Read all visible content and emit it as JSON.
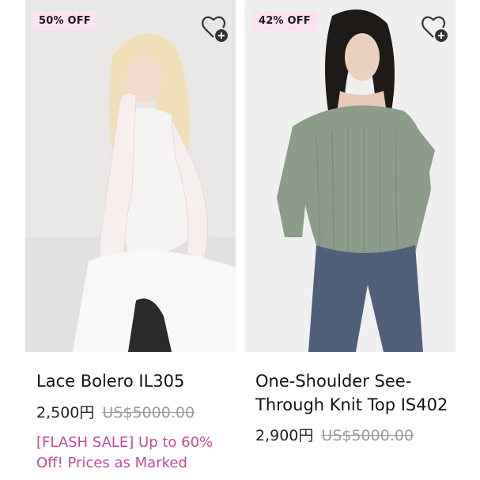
{
  "products": [
    {
      "discount_badge": "50% OFF",
      "title": "Lace Bolero IL305",
      "price": "2,500円",
      "original_price": "US$5000.00",
      "promo": "[FLASH SALE] Up to 60% Off! Prices as Marked",
      "image_icon": "model-photo-lace-bolero",
      "wishlist_icon": "heart-plus-icon"
    },
    {
      "discount_badge": "42% OFF",
      "title": "One-Shoulder See-Through Knit Top IS402",
      "price": "2,900円",
      "original_price": "US$5000.00",
      "image_icon": "model-photo-knit-top",
      "wishlist_icon": "heart-plus-icon"
    }
  ],
  "colors": {
    "badge_bg": "#fbe3ef",
    "promo_text": "#c24b9b",
    "strike_price": "#9b9b9b"
  }
}
